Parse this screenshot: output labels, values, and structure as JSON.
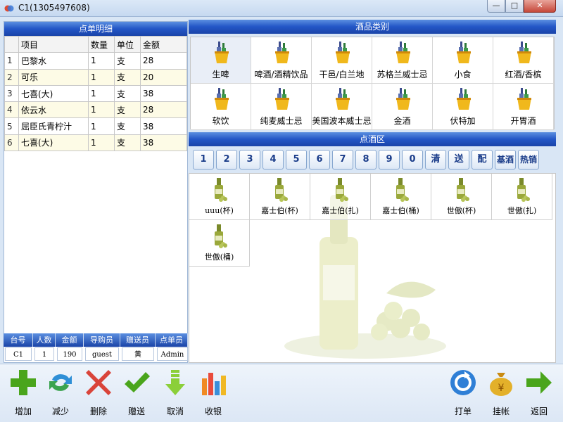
{
  "window": {
    "title": "C1(1305497608)",
    "minimize": "—",
    "maximize": "□",
    "close": "✕"
  },
  "order": {
    "header": "点单明细",
    "columns": [
      "项目",
      "数量",
      "单位",
      "金额"
    ],
    "rows": [
      {
        "n": "1",
        "item": "巴黎水",
        "qty": "1",
        "unit": "支",
        "amount": "28"
      },
      {
        "n": "2",
        "item": "可乐",
        "qty": "1",
        "unit": "支",
        "amount": "20"
      },
      {
        "n": "3",
        "item": "七喜(大)",
        "qty": "1",
        "unit": "支",
        "amount": "38"
      },
      {
        "n": "4",
        "item": "依云水",
        "qty": "1",
        "unit": "支",
        "amount": "28"
      },
      {
        "n": "5",
        "item": "屈臣氏青柠汁",
        "qty": "1",
        "unit": "支",
        "amount": "38"
      },
      {
        "n": "6",
        "item": "七喜(大)",
        "qty": "1",
        "unit": "支",
        "amount": "38"
      }
    ]
  },
  "summary": {
    "headers": [
      "台号",
      "人数",
      "金额",
      "导购员",
      "赠送员",
      "点单员"
    ],
    "values": [
      "C1",
      "1",
      "190",
      "guest",
      "黄",
      "Admin"
    ]
  },
  "categories": {
    "header": "酒品类别",
    "items": [
      "生啤",
      "啤酒/酒精饮品",
      "干邑/白兰地",
      "苏格兰威士忌",
      "小食",
      "红酒/香槟",
      "软饮",
      "纯麦威士忌",
      "美国波本威士忌",
      "金酒",
      "伏特加",
      "开胃酒"
    ],
    "selected": "生啤"
  },
  "order_area": {
    "header": "点酒区",
    "buttons": [
      "1",
      "2",
      "3",
      "4",
      "5",
      "6",
      "7",
      "8",
      "9",
      "0",
      "清",
      "送",
      "配",
      "基酒",
      "热销"
    ],
    "drinks": [
      "uuu(杯)",
      "嘉士伯(杯)",
      "嘉士伯(扎)",
      "嘉士伯(桶)",
      "世傲(杯)",
      "世傲(扎)",
      "世傲(桶)"
    ]
  },
  "toolbar": {
    "left": [
      {
        "label": "增加",
        "icon": "plus-icon",
        "color": "#4aa51c"
      },
      {
        "label": "减少",
        "icon": "refresh-arrows-icon",
        "color": "#2f8fd6"
      },
      {
        "label": "删除",
        "icon": "delete-x-icon",
        "color": "#d9443a"
      },
      {
        "label": "赠送",
        "icon": "checkmark-icon",
        "color": "#4aa51c"
      },
      {
        "label": "取消",
        "icon": "down-arrow-icon",
        "color": "#8bcf3a"
      },
      {
        "label": "收银",
        "icon": "bar-chart-icon",
        "color": "#f08a24"
      }
    ],
    "right": [
      {
        "label": "打单",
        "icon": "circular-arrow-icon",
        "color": "#2f7fd6"
      },
      {
        "label": "挂帐",
        "icon": "money-bag-icon",
        "color": "#d9a21c"
      },
      {
        "label": "返回",
        "icon": "right-arrow-icon",
        "color": "#4aa51c"
      }
    ]
  }
}
